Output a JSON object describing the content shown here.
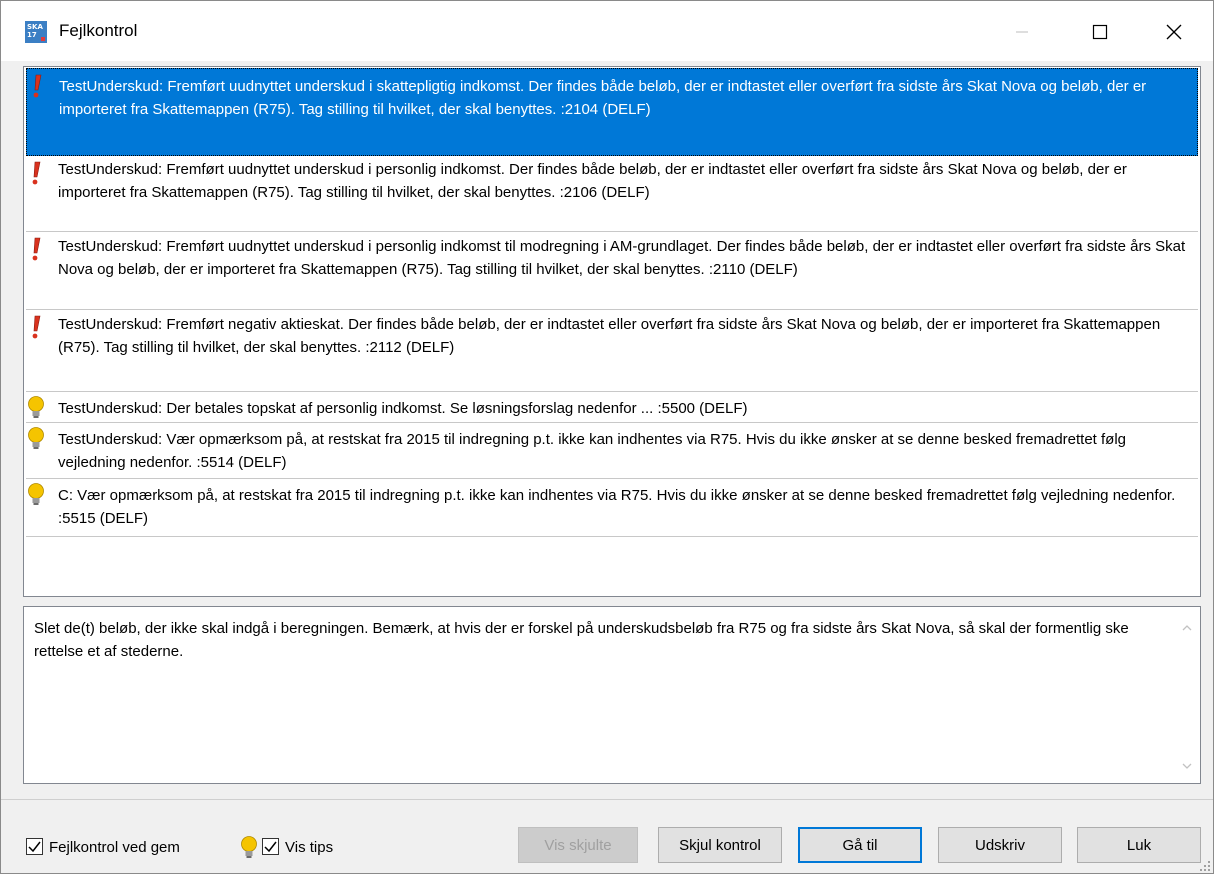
{
  "window": {
    "title": "Fejlkontrol",
    "icon_text": "SKA 17",
    "buttons": [
      "minimize-icon",
      "maximize-icon",
      "close-icon"
    ]
  },
  "messages": [
    {
      "type": "error",
      "icon": "exclamation-icon",
      "selected": true,
      "text": "TestUnderskud: Fremført uudnyttet underskud i skattepligtig indkomst. Der findes både beløb, der er indtastet eller overført fra sidste års Skat Nova og beløb, der er importeret fra Skattemappen (R75). Tag stilling til hvilket, der skal benyttes. :2104 (DELF)"
    },
    {
      "type": "error",
      "icon": "exclamation-icon",
      "selected": false,
      "text": "TestUnderskud: Fremført uudnyttet underskud i personlig indkomst. Der findes både beløb, der er indtastet eller overført fra sidste års Skat Nova og beløb, der er importeret fra Skattemappen (R75). Tag stilling til hvilket, der skal benyttes. :2106 (DELF)"
    },
    {
      "type": "error",
      "icon": "exclamation-icon",
      "selected": false,
      "text": "TestUnderskud: Fremført uudnyttet underskud i personlig indkomst til modregning i AM-grundlaget. Der findes både beløb, der er indtastet eller overført fra sidste års Skat Nova og beløb, der er importeret fra Skattemappen (R75). Tag stilling til hvilket, der skal benyttes. :2110 (DELF)"
    },
    {
      "type": "error",
      "icon": "exclamation-icon",
      "selected": false,
      "text": "TestUnderskud: Fremført negativ aktieskat. Der findes både beløb, der er indtastet eller overført fra sidste års Skat Nova og beløb, der er importeret fra Skattemappen (R75). Tag stilling til hvilket, der skal benyttes. :2112 (DELF)"
    },
    {
      "type": "tip",
      "icon": "lightbulb-icon",
      "selected": false,
      "text": "TestUnderskud: Der betales topskat af personlig indkomst. Se løsningsforslag nedenfor ...     :5500 (DELF)"
    },
    {
      "type": "tip",
      "icon": "lightbulb-icon",
      "selected": false,
      "text": "TestUnderskud: Vær opmærksom på, at restskat fra 2015 til indregning p.t. ikke kan indhentes via R75. Hvis du ikke ønsker at se denne besked fremadrettet følg vejledning nedenfor. :5514 (DELF)"
    },
    {
      "type": "tip",
      "icon": "lightbulb-icon",
      "selected": false,
      "text": "C: Vær opmærksom på, at restskat fra 2015 til indregning p.t. ikke kan indhentes via R75. Hvis du ikke ønsker at se denne besked fremadrettet følg vejledning nedenfor. :5515 (DELF)"
    }
  ],
  "description": {
    "text": "Slet de(t) beløb, der ikke skal indgå i beregningen. Bemærk, at hvis der er forskel på underskudsbeløb fra R75 og fra sidste års Skat Nova, så skal der formentlig ske rettelse et af stederne."
  },
  "footer": {
    "fejlkontrol_label": "Fejlkontrol ved gem",
    "fejlkontrol_checked": true,
    "vis_tips_label": "Vis tips",
    "vis_tips_checked": true
  },
  "buttons": {
    "vis_skjulte": "Vis skjulte",
    "skjul_kontrol": "Skjul kontrol",
    "gaa_til": "Gå til",
    "udskriv": "Udskriv",
    "luk": "Luk"
  },
  "colors": {
    "selection": "#0078d7",
    "error_icon": "#d9321e",
    "tip_icon": "#f5c400",
    "window_bg": "#f0f0f0"
  }
}
